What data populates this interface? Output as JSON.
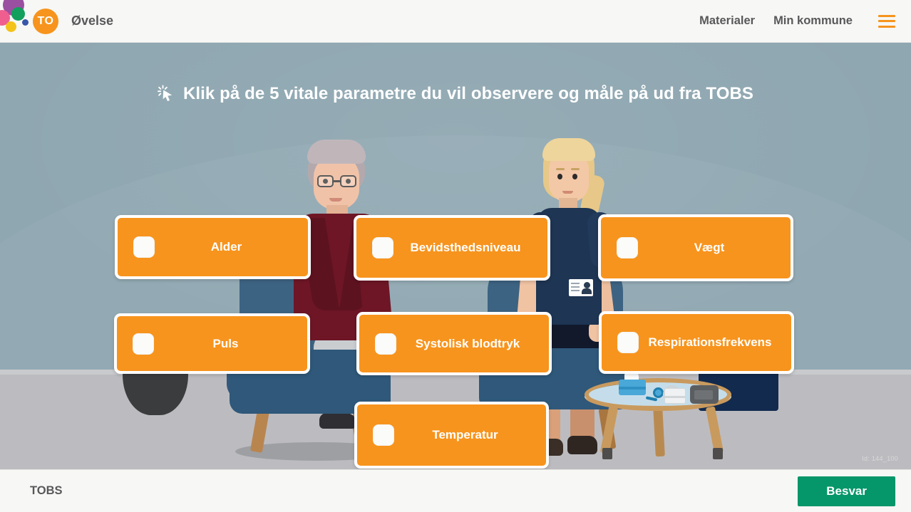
{
  "header": {
    "logo_initials": "TO",
    "title": "Øvelse",
    "nav": [
      {
        "label": "Materialer"
      },
      {
        "label": "Min kommune"
      }
    ],
    "menu_icon": "hamburger-menu-icon"
  },
  "quiz": {
    "instruction": "Klik på de 5 vitale parametre du vil observere og måle på ud fra TOBS",
    "instruction_icon": "click-cursor-icon",
    "options": [
      {
        "label": "Alder",
        "checked": false
      },
      {
        "label": "Bevidsthedsniveau",
        "checked": false
      },
      {
        "label": "Vægt",
        "checked": false
      },
      {
        "label": "Puls",
        "checked": false
      },
      {
        "label": "Systolisk blodtryk",
        "checked": false
      },
      {
        "label": "Respirationsfrekvens",
        "checked": false
      },
      {
        "label": "Temperatur",
        "checked": false
      }
    ],
    "image_id": "Id: 144_100"
  },
  "footer": {
    "topic_label": "TOBS",
    "submit_label": "Besvar"
  },
  "colors": {
    "brand_orange": "#f7941d",
    "submit_green": "#059669",
    "wall": "#8fa7b1",
    "floor": "#bcbcc0",
    "text_gray": "#58585a"
  }
}
